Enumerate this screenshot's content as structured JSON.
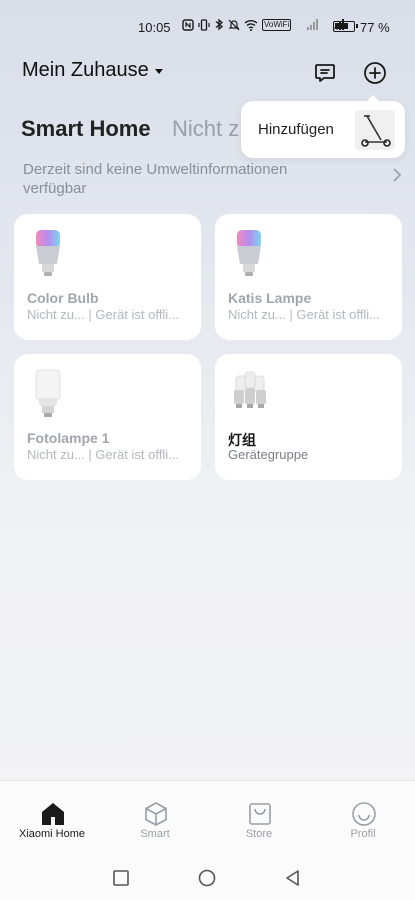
{
  "status_bar": {
    "time": "10:05",
    "icons": [
      "nfc-icon",
      "vibrate-icon",
      "bluetooth-icon",
      "mute-icon",
      "wifi-icon",
      "volte-icon",
      "signal-icon",
      "signal-icon"
    ],
    "volte_label": "VoWiFi",
    "battery_percent": 77,
    "battery_text": "77 %"
  },
  "header": {
    "home_name": "Mein Zuhause",
    "message_icon": "message-icon",
    "add_icon": "add-circle-icon"
  },
  "tabs": {
    "active": "Smart Home",
    "inactive": "Nicht z"
  },
  "popup": {
    "label": "Hinzufügen",
    "thumb_icon": "scooter-icon"
  },
  "env_info": {
    "text": "Derzeit sind keine Umweltinformationen verfügbar",
    "arrow_icon": "chevron-right-icon"
  },
  "devices": [
    {
      "name": "Color Bulb",
      "status": "Nicht zu...  | Gerät ist offli...",
      "icon": "color-bulb-icon",
      "online": false
    },
    {
      "name": "Katis Lampe",
      "status": "Nicht zu...  | Gerät ist offli...",
      "icon": "color-bulb-icon",
      "online": false
    },
    {
      "name": "Fotolampe 1",
      "status": "Nicht zu...  | Gerät ist offli...",
      "icon": "white-bulb-icon",
      "online": false
    },
    {
      "name": "灯组",
      "status": "Gerätegruppe",
      "icon": "bulb-group-icon",
      "online": true
    }
  ],
  "bottom_nav": [
    {
      "label": "Xiaomi Home",
      "icon": "home-icon",
      "active": true
    },
    {
      "label": "Smart",
      "icon": "cube-icon",
      "active": false
    },
    {
      "label": "Store",
      "icon": "store-bag-icon",
      "active": false
    },
    {
      "label": "Profil",
      "icon": "smiley-icon",
      "active": false
    }
  ],
  "system_nav": [
    "square-icon",
    "circle-icon",
    "back-triangle-icon"
  ],
  "colors": {
    "background_top": "#d9dee9",
    "background_bottom": "#f4f4f6",
    "card": "#ffffff",
    "muted_text": "#a2a5ad"
  }
}
